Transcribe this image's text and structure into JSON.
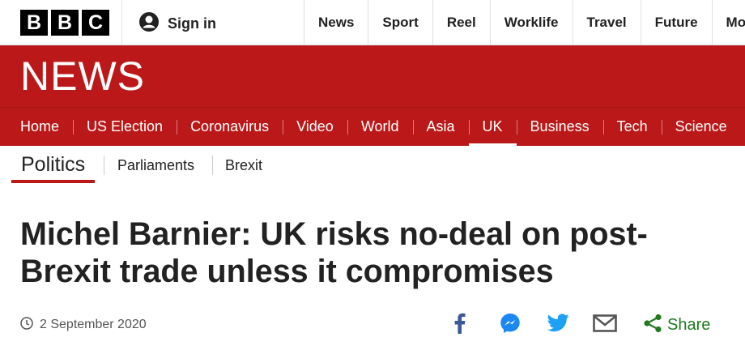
{
  "masthead": {
    "logo_letters": [
      "B",
      "B",
      "C"
    ],
    "signin_label": "Sign in",
    "nav": [
      "News",
      "Sport",
      "Reel",
      "Worklife",
      "Travel",
      "Future",
      "Mo"
    ]
  },
  "brand": {
    "wordmark": "NEWS",
    "band_color": "#bb1919"
  },
  "section_nav": {
    "items": [
      "Home",
      "US Election",
      "Coronavirus",
      "Video",
      "World",
      "Asia",
      "UK",
      "Business",
      "Tech",
      "Science"
    ],
    "active": "UK"
  },
  "sub_nav": {
    "primary": "Politics",
    "items": [
      "Parliaments",
      "Brexit"
    ]
  },
  "article": {
    "headline_line1": "Michel Barnier: UK risks no-deal on post-",
    "headline_line2": "Brexit trade unless it compromises",
    "date": "2 September 2020"
  },
  "share": {
    "icons": [
      "facebook-icon",
      "messenger-icon",
      "twitter-icon",
      "email-icon",
      "share-icon"
    ],
    "label": "Share",
    "accent": "#1f7a1f"
  }
}
